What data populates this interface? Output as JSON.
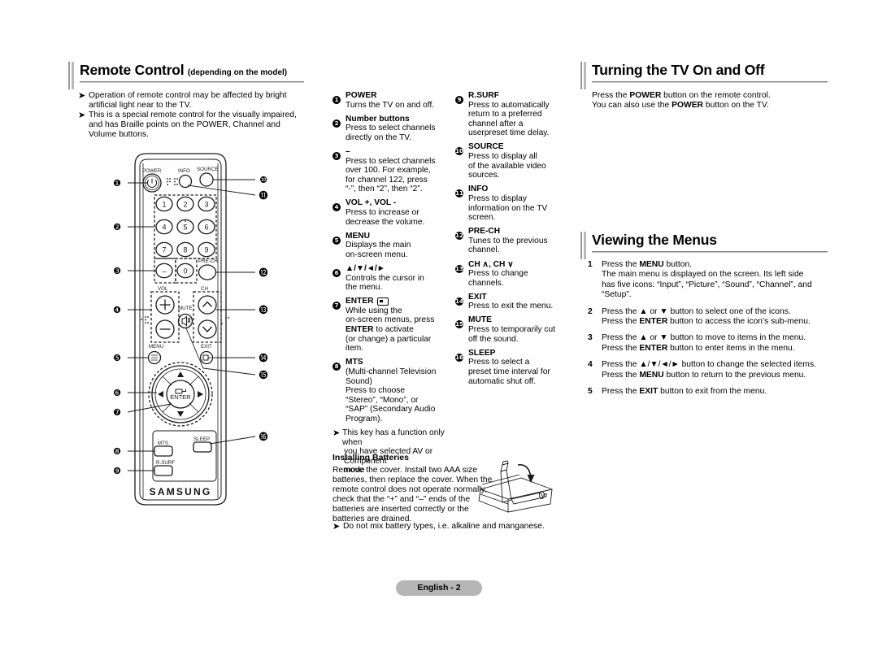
{
  "sections": {
    "remote_control": {
      "title": "Remote Control",
      "subtitle": "(depending on the model)",
      "notes": [
        "Operation of remote control may be affected by bright artificial light near to the TV.",
        "This is a special remote control for the visually impaired, and has Braille points on the POWER, Channel and Volume buttons."
      ]
    },
    "turning_tv": {
      "title": "Turning the TV On and Off",
      "line1_a": "Press the ",
      "line1_b": "POWER",
      "line1_c": " button on the remote control.",
      "line2_a": "You can also use the ",
      "line2_b": "POWER",
      "line2_c": " button on the TV."
    },
    "viewing_menus": {
      "title": "Viewing the Menus",
      "steps": [
        {
          "n": "1",
          "lines": [
            [
              {
                "t": "Press the "
              },
              {
                "t": "MENU",
                "b": true
              },
              {
                "t": " button."
              }
            ],
            [
              {
                "t": "The main menu is displayed on the screen. Its left side"
              }
            ],
            [
              {
                "t": "has five icons: “Input”, “Picture”, “Sound”, “Channel”, and"
              }
            ],
            [
              {
                "t": "“Setup”."
              }
            ]
          ]
        },
        {
          "n": "2",
          "lines": [
            [
              {
                "t": "Press the ▲ or ▼ button to select one of the icons."
              }
            ],
            [
              {
                "t": "Press the "
              },
              {
                "t": "ENTER",
                "b": true
              },
              {
                "t": " button to access the icon’s sub-menu."
              }
            ]
          ]
        },
        {
          "n": "3",
          "lines": [
            [
              {
                "t": "Press the ▲ or ▼ button to move to items in the menu."
              }
            ],
            [
              {
                "t": "Press the "
              },
              {
                "t": "ENTER",
                "b": true
              },
              {
                "t": " button to enter items in the menu."
              }
            ]
          ]
        },
        {
          "n": "4",
          "lines": [
            [
              {
                "t": "Press the ▲/▼/◄/► button to change the selected items."
              }
            ],
            [
              {
                "t": "Press the "
              },
              {
                "t": "MENU",
                "b": true
              },
              {
                "t": " button to return to the previous menu."
              }
            ]
          ]
        },
        {
          "n": "5",
          "lines": [
            [
              {
                "t": "Press the "
              },
              {
                "t": "EXIT",
                "b": true
              },
              {
                "t": " button to exit from the menu."
              }
            ]
          ]
        }
      ]
    },
    "installing_batteries": {
      "title": "Installing Batteries",
      "paragraph": "Remove the cover. Install two AAA size batteries, then replace the cover. When the remote control does not operate normally, check that the “+” and “–” ends of the batteries are inserted correctly or the batteries are drained.",
      "note": "Do not mix battery types, i.e. alkaline and manganese."
    }
  },
  "key_list_col1": [
    {
      "n": "1",
      "num_glyph": "❶",
      "label": "POWER",
      "desc": [
        "Turns the TV on and off."
      ]
    },
    {
      "n": "2",
      "num_glyph": "❷",
      "label": "Number buttons",
      "desc": [
        "Press to select channels",
        "directly on the TV."
      ]
    },
    {
      "n": "3",
      "num_glyph": "❸",
      "label": "–",
      "desc": [
        "Press to select channels",
        "over 100. For example,",
        "for channel 122, press",
        "“-”, then “2”, then “2”."
      ]
    },
    {
      "n": "4",
      "num_glyph": "❹",
      "label": "VOL +, VOL -",
      "desc": [
        "Press to increase or",
        "decrease the volume."
      ]
    },
    {
      "n": "5",
      "num_glyph": "❺",
      "label": "MENU",
      "desc": [
        "Displays the main",
        "on-screen menu."
      ]
    },
    {
      "n": "6",
      "num_glyph": "❻",
      "label": "▲/▼/◄/►",
      "desc": [
        "Controls the cursor in",
        "the menu."
      ]
    },
    {
      "n": "7",
      "num_glyph": "❼",
      "label": "ENTER",
      "label_icon": "enter-icon",
      "desc": [
        "While using the",
        "on-screen menus, press",
        "ENTER to activate",
        "(or change) a particular",
        "item."
      ]
    },
    {
      "n": "8",
      "num_glyph": "❽",
      "label": "MTS",
      "desc": [
        "(Multi-channel Television",
        "Sound)",
        "Press to choose",
        "“Stereo”, “Mono”, or",
        "“SAP” (Secondary Audio",
        "Program)."
      ]
    }
  ],
  "key_list_col1_note": [
    "This key has a function only when",
    "you have selected AV or Component",
    "mode"
  ],
  "key_list_col2": [
    {
      "n": "9",
      "num_glyph": "❾",
      "label": "R.SURF",
      "desc": [
        "Press to automatically",
        "return to a preferred",
        "channel after a",
        "userpreset time delay."
      ]
    },
    {
      "n": "10",
      "num_glyph": "❿",
      "label": "SOURCE",
      "desc": [
        "Press to display all",
        "of the available video",
        "sources."
      ]
    },
    {
      "n": "11",
      "num_glyph": "⓫",
      "label": "INFO",
      "desc": [
        "Press to display",
        "information on the TV",
        "screen."
      ]
    },
    {
      "n": "12",
      "num_glyph": "⓬",
      "label": "PRE-CH",
      "desc": [
        "Tunes to the previous",
        "channel."
      ]
    },
    {
      "n": "13",
      "num_glyph": "⓭",
      "label": "CH ∧, CH ∨",
      "desc": [
        "Press to change",
        "channels."
      ]
    },
    {
      "n": "14",
      "num_glyph": "⓮",
      "label": "EXIT",
      "desc": [
        "Press to exit the menu."
      ]
    },
    {
      "n": "15",
      "num_glyph": "⓯",
      "label": "MUTE",
      "desc": [
        "Press to temporarily cut",
        "off the sound."
      ]
    },
    {
      "n": "16",
      "num_glyph": "⓰",
      "label": "SLEEP",
      "desc": [
        "Press to select a",
        "preset time interval for",
        "automatic shut off."
      ]
    }
  ],
  "remote": {
    "brand": "SAMSUNG",
    "button_labels": {
      "power": "POWER",
      "info": "INFO",
      "source": "SOURCE",
      "pre_ch": "PRE-CH",
      "vol": "VOL",
      "ch": "CH",
      "mute": "MUTE",
      "menu": "MENU",
      "exit": "EXIT",
      "enter": "ENTER",
      "mts": "MTS",
      "rsurf": "R.SURF",
      "sleep": "SLEEP"
    },
    "numbers": [
      "1",
      "2",
      "3",
      "4",
      "5",
      "6",
      "7",
      "8",
      "9",
      "0"
    ],
    "minus": "–",
    "callouts_left": [
      "1",
      "2",
      "3",
      "4",
      "5",
      "6",
      "7",
      "8",
      "9"
    ],
    "callouts_right": [
      "10",
      "11",
      "12",
      "13",
      "14",
      "15",
      "16"
    ],
    "callout_glyphs_left": [
      "❶",
      "❷",
      "❸",
      "❹",
      "❺",
      "❻",
      "❼",
      "❽",
      "❾"
    ],
    "callout_glyphs_right": [
      "❿",
      "⓫",
      "⓬",
      "⓭",
      "⓮",
      "⓯",
      "⓰"
    ]
  },
  "footer": {
    "label": "English - 2"
  },
  "colors": {
    "ink": "#000000",
    "rule_dark": "#7d7d7d",
    "rule_light": "#c9c9c9",
    "footer_bg": "#b5b5b5"
  }
}
